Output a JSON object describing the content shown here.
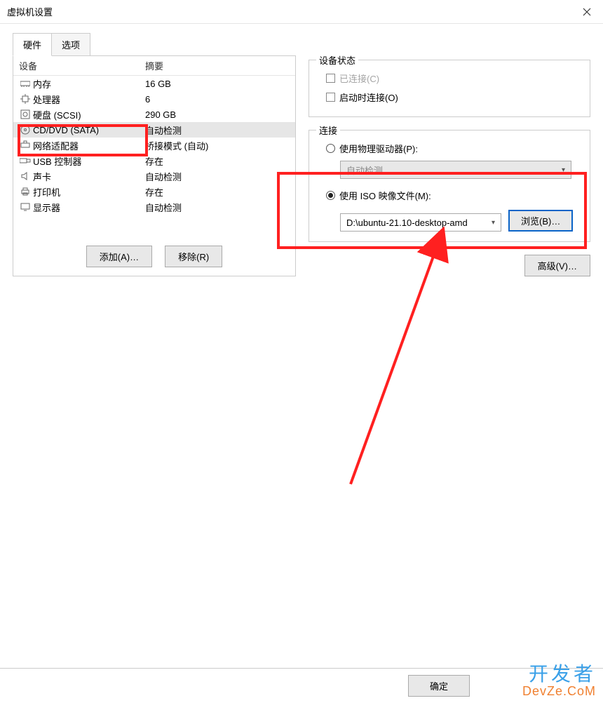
{
  "title": "虚拟机设置",
  "tabs": {
    "hardware": "硬件",
    "options": "选项"
  },
  "hw_header": {
    "device": "设备",
    "summary": "摘要"
  },
  "hw": [
    {
      "icon": "memory",
      "label": "内存",
      "summary": "16 GB"
    },
    {
      "icon": "cpu",
      "label": "处理器",
      "summary": "6"
    },
    {
      "icon": "disk",
      "label": "硬盘 (SCSI)",
      "summary": "290 GB"
    },
    {
      "icon": "cd",
      "label": "CD/DVD (SATA)",
      "summary": "自动检测",
      "selected": true
    },
    {
      "icon": "net",
      "label": "网络适配器",
      "summary": "桥接模式 (自动)"
    },
    {
      "icon": "usb",
      "label": "USB 控制器",
      "summary": "存在"
    },
    {
      "icon": "sound",
      "label": "声卡",
      "summary": "自动检测"
    },
    {
      "icon": "printer",
      "label": "打印机",
      "summary": "存在"
    },
    {
      "icon": "display",
      "label": "显示器",
      "summary": "自动检测"
    }
  ],
  "buttons": {
    "add": "添加(A)…",
    "remove": "移除(R)",
    "advanced": "高级(V)…",
    "browse": "浏览(B)…",
    "ok": "确定"
  },
  "status": {
    "legend": "设备状态",
    "connected": "已连接(C)",
    "connect_on_start": "启动时连接(O)"
  },
  "connection": {
    "legend": "连接",
    "physical": "使用物理驱动器(P):",
    "auto_detect": "自动检测",
    "iso": "使用 ISO 映像文件(M):",
    "iso_path": "D:\\ubuntu-21.10-desktop-amd"
  },
  "watermark": {
    "line1": "开发者",
    "line2": "DevZe.CoM"
  }
}
